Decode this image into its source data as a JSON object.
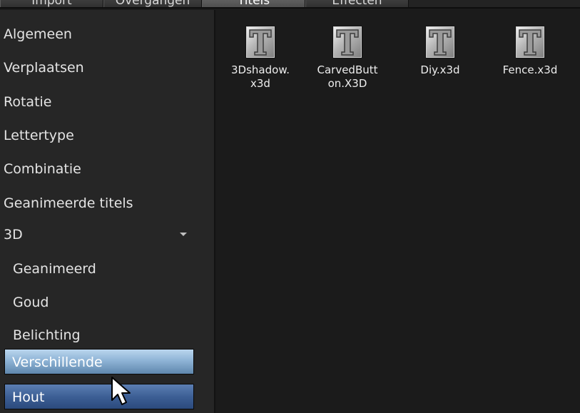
{
  "tabs": [
    {
      "label": "Import"
    },
    {
      "label": "Overgangen"
    },
    {
      "label": "Titels"
    },
    {
      "label": "Effecten"
    }
  ],
  "sidebar": {
    "items": [
      {
        "label": "Algemeen"
      },
      {
        "label": "Verplaatsen"
      },
      {
        "label": "Rotatie"
      },
      {
        "label": "Lettertype"
      },
      {
        "label": "Combinatie"
      },
      {
        "label": "Geanimeerde titels"
      },
      {
        "label": "3D",
        "icon": "chevron-down-icon"
      },
      {
        "label": "Geanimeerd"
      },
      {
        "label": "Goud"
      },
      {
        "label": "Belichting"
      },
      {
        "label": "Verschillende"
      },
      {
        "label": "Hout"
      }
    ]
  },
  "templates": [
    {
      "label": "3Dshadow.x3d",
      "icon": "title-template-icon"
    },
    {
      "label": "CarvedButton.X3D",
      "icon": "title-template-icon"
    },
    {
      "label": "Diy.x3d",
      "icon": "title-template-icon"
    },
    {
      "label": "Fence.x3d",
      "icon": "title-template-icon"
    }
  ],
  "colors": {
    "background": "#1b1b1b",
    "sidebar": "#262626",
    "selection_light": "#8fb4d6",
    "selection_dark": "#3d5f95"
  }
}
